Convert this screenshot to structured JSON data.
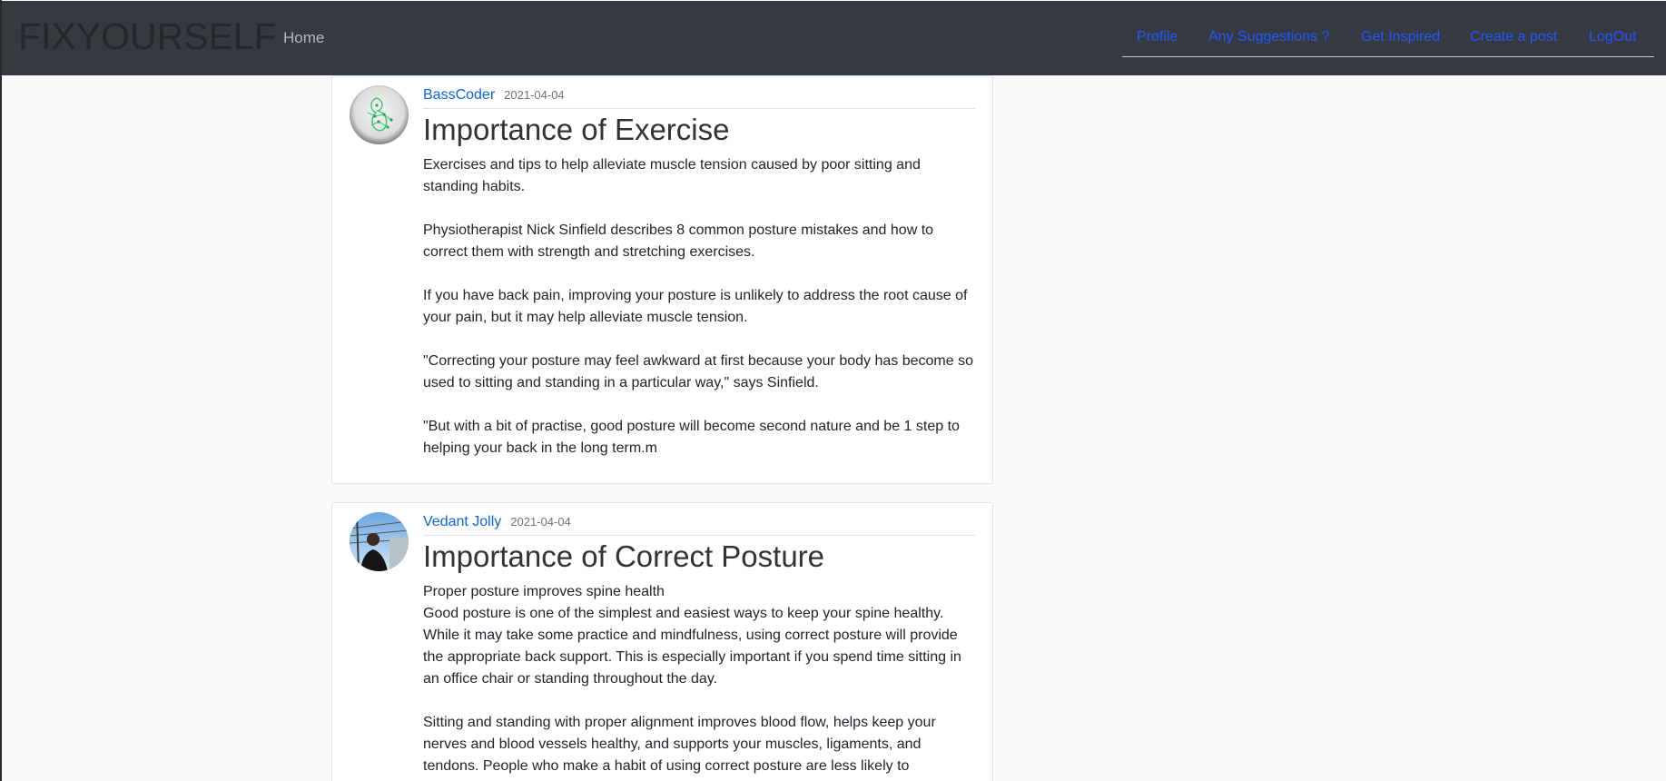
{
  "navbar": {
    "brand": "FIXYOURSELF",
    "home": "Home",
    "links": [
      "Profile",
      "Any Suggestions ?",
      "Get Inspired",
      "Create a post",
      "LogOut"
    ]
  },
  "posts": [
    {
      "author": "BassCoder",
      "date": "2021-04-04",
      "title": "Importance of Exercise",
      "paragraphs": [
        "Exercises and tips to help alleviate muscle tension caused by poor sitting and standing habits.",
        "Physiotherapist Nick Sinfield describes 8 common posture mistakes and how to correct them with strength and stretching exercises.",
        "If you have back pain, improving your posture is unlikely to address the root cause of your pain, but it may help alleviate muscle tension.",
        "\"Correcting your posture may feel awkward at first because your body has become so used to sitting and standing in a particular way,\" says Sinfield.",
        "\"But with a bit of practise, good posture will become second nature and be 1 step to helping your back in the long term.m"
      ]
    },
    {
      "author": "Vedant Jolly",
      "date": "2021-04-04",
      "title": "Importance of Correct Posture",
      "lead": "Proper posture improves spine health",
      "paragraphs": [
        "Good posture is one of the simplest and easiest ways to keep your spine healthy. While it may take some practice and mindfulness, using correct posture will provide the appropriate back support. This is especially important if you spend time sitting in an office chair or standing throughout the day.",
        "Sitting and standing with proper alignment improves blood flow, helps keep your nerves and blood vessels healthy, and supports your muscles, ligaments, and tendons. People who make a habit of using correct posture are less likely to"
      ]
    }
  ],
  "colors": {
    "navbar_bg": "#343a40",
    "link": "#2255ff",
    "author_link": "#0b63e5",
    "page_bg": "#fafafa"
  }
}
